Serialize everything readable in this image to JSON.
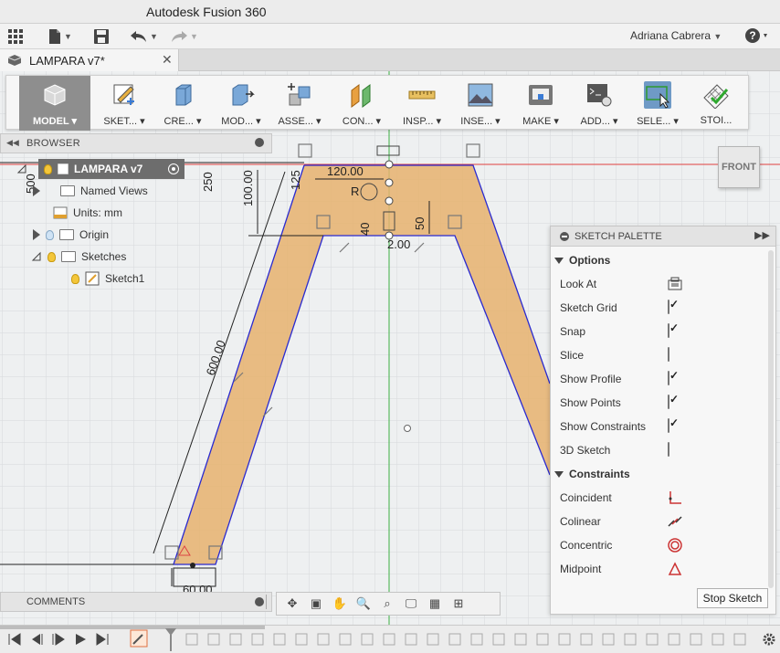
{
  "window": {
    "title": "Autodesk Fusion 360"
  },
  "quick_access": {
    "user": "Adriana Cabrera",
    "icons": [
      "grid-icon",
      "file-icon",
      "save-icon",
      "undo-icon",
      "redo-icon",
      "help-icon"
    ]
  },
  "document": {
    "tab_name": "LAMPARA v7*"
  },
  "toolbar": {
    "items": [
      {
        "label": "MODEL ▾",
        "icon": "model-icon"
      },
      {
        "label": "SKET... ▾",
        "icon": "sketch-icon"
      },
      {
        "label": "CRE... ▾",
        "icon": "create-icon"
      },
      {
        "label": "MOD... ▾",
        "icon": "modify-icon"
      },
      {
        "label": "ASSE... ▾",
        "icon": "assemble-icon"
      },
      {
        "label": "CON... ▾",
        "icon": "construct-icon"
      },
      {
        "label": "INSP... ▾",
        "icon": "inspect-icon"
      },
      {
        "label": "INSE... ▾",
        "icon": "insert-icon"
      },
      {
        "label": "MAKE ▾",
        "icon": "make-icon"
      },
      {
        "label": "ADD... ▾",
        "icon": "addins-icon"
      },
      {
        "label": "SELE... ▾",
        "icon": "select-icon"
      },
      {
        "label": "STOI...",
        "icon": "stop-sketch-icon"
      }
    ]
  },
  "browser": {
    "title": "BROWSER",
    "root": "LAMPARA v7",
    "items": {
      "named_views": "Named Views",
      "units": "Units: mm",
      "origin": "Origin",
      "sketches": "Sketches",
      "sketch1": "Sketch1"
    }
  },
  "viewcube": {
    "face": "FRONT"
  },
  "sketch": {
    "dimensions": {
      "d600": "600.00",
      "d100": "100.00",
      "d120": "120.00",
      "d250": "250",
      "d125": "125",
      "d500": "500",
      "d60": "60.00",
      "d2": "2.00",
      "d40": "40",
      "d50": "50",
      "r": "R"
    },
    "colors": {
      "profile_fill": "#e6b26e",
      "line": "#2a2ad0",
      "axis_green": "#3cb043",
      "axis_red": "#e04040"
    }
  },
  "palette": {
    "title": "SKETCH PALETTE",
    "options_label": "Options",
    "options": [
      {
        "label": "Look At",
        "type": "icon",
        "icon": "look-at-icon"
      },
      {
        "label": "Sketch Grid",
        "type": "check",
        "checked": true
      },
      {
        "label": "Snap",
        "type": "check",
        "checked": true
      },
      {
        "label": "Slice",
        "type": "check",
        "checked": false
      },
      {
        "label": "Show Profile",
        "type": "check",
        "checked": true
      },
      {
        "label": "Show Points",
        "type": "check",
        "checked": true
      },
      {
        "label": "Show Constraints",
        "type": "check",
        "checked": true
      },
      {
        "label": "3D Sketch",
        "type": "check",
        "checked": false
      }
    ],
    "constraints_label": "Constraints",
    "constraints": [
      {
        "label": "Coincident",
        "icon": "coincident-icon"
      },
      {
        "label": "Colinear",
        "icon": "colinear-icon"
      },
      {
        "label": "Concentric",
        "icon": "concentric-icon"
      },
      {
        "label": "Midpoint",
        "icon": "midpoint-icon"
      }
    ],
    "stop_label": "Stop Sketch"
  },
  "comments": {
    "title": "COMMENTS"
  }
}
